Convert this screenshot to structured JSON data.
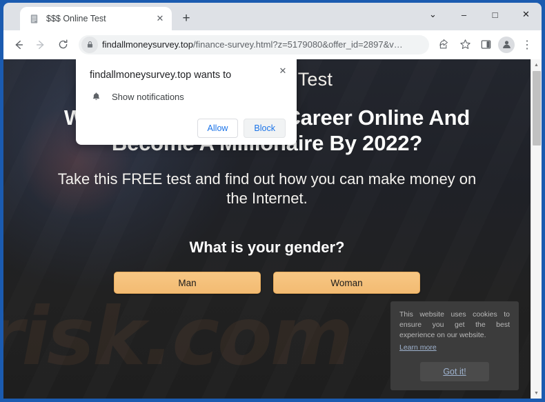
{
  "browser": {
    "tab": {
      "title": "$$$ Online Test",
      "favicon": "document-icon",
      "close_label": "✕"
    },
    "new_tab_label": "+",
    "window_controls": {
      "list_label": "⌄",
      "minimize_label": "–",
      "maximize_label": "□",
      "close_label": "✕"
    },
    "toolbar": {
      "back_label": "←",
      "forward_label": "→",
      "reload_label": "⟳",
      "share_label": "share-icon",
      "bookmark_label": "☆",
      "sidepanel_label": "sidepanel-icon",
      "profile_label": "profile-icon",
      "menu_label": "⋮"
    },
    "omnibox": {
      "lock": "lock-icon",
      "url_domain": "findallmoneysurvey.top",
      "url_path": "/finance-survey.html?z=5179080&offer_id=2897&v…"
    }
  },
  "permission_dialog": {
    "title": "findallmoneysurvey.top wants to",
    "permission_icon": "bell-icon",
    "permission_label": "Show notifications",
    "allow_label": "Allow",
    "block_label": "Block",
    "close_label": "✕"
  },
  "page": {
    "site_title": "$$$ Online Test",
    "headline": "Want To Start A Great Career Online And Become A Millionaire By 2022?",
    "subtitle": "Take this FREE test and find out how you can make money on the Internet.",
    "question": "What is your gender?",
    "answers": [
      {
        "label": "Man"
      },
      {
        "label": "Woman"
      }
    ],
    "watermark": "risk.com",
    "colors": {
      "answer_button": "#f3bb72",
      "background": "#212121",
      "text": "#ffffff"
    }
  },
  "cookie_banner": {
    "text": "This website uses cookies to ensure you get the best experience on our website.",
    "learn_more_label": "Learn more",
    "accept_label": "Got it!"
  }
}
